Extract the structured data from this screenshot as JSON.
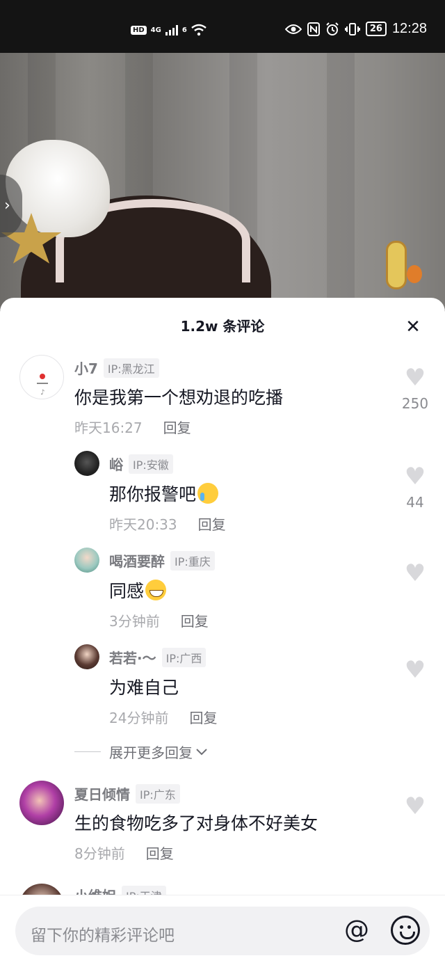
{
  "status_bar": {
    "hd": "HD",
    "network_top": "4G",
    "network_wifi": "6",
    "battery": "26",
    "time": "12:28"
  },
  "comments_panel": {
    "title": "1.2w 条评论",
    "close_icon": "close-icon",
    "expand_label": "展开更多回复",
    "comments": [
      {
        "user": "小7",
        "ip": "IP:黑龙江",
        "text": "你是我第一个想劝退的吃播",
        "time": "昨天16:27",
        "reply": "回复",
        "likes": "250"
      },
      {
        "user": "峪",
        "ip": "IP:安徽",
        "text": "那你报警吧",
        "time": "昨天20:33",
        "reply": "回复",
        "likes": "44"
      },
      {
        "user": "喝酒要醉",
        "ip": "IP:重庆",
        "text": "同感",
        "time": "3分钟前",
        "reply": "回复"
      },
      {
        "user": "若若·～",
        "ip": "IP:广西",
        "text": "为难自己",
        "time": "24分钟前",
        "reply": "回复"
      },
      {
        "user": "夏日倾情",
        "ip": "IP:广东",
        "text": "生的食物吃多了对身体不好美女",
        "time": "8分钟前",
        "reply": "回复"
      },
      {
        "user": "小维妲",
        "ip": "IP:天津"
      }
    ]
  },
  "input_bar": {
    "placeholder": "留下你的精彩评论吧",
    "at_label": "@"
  }
}
